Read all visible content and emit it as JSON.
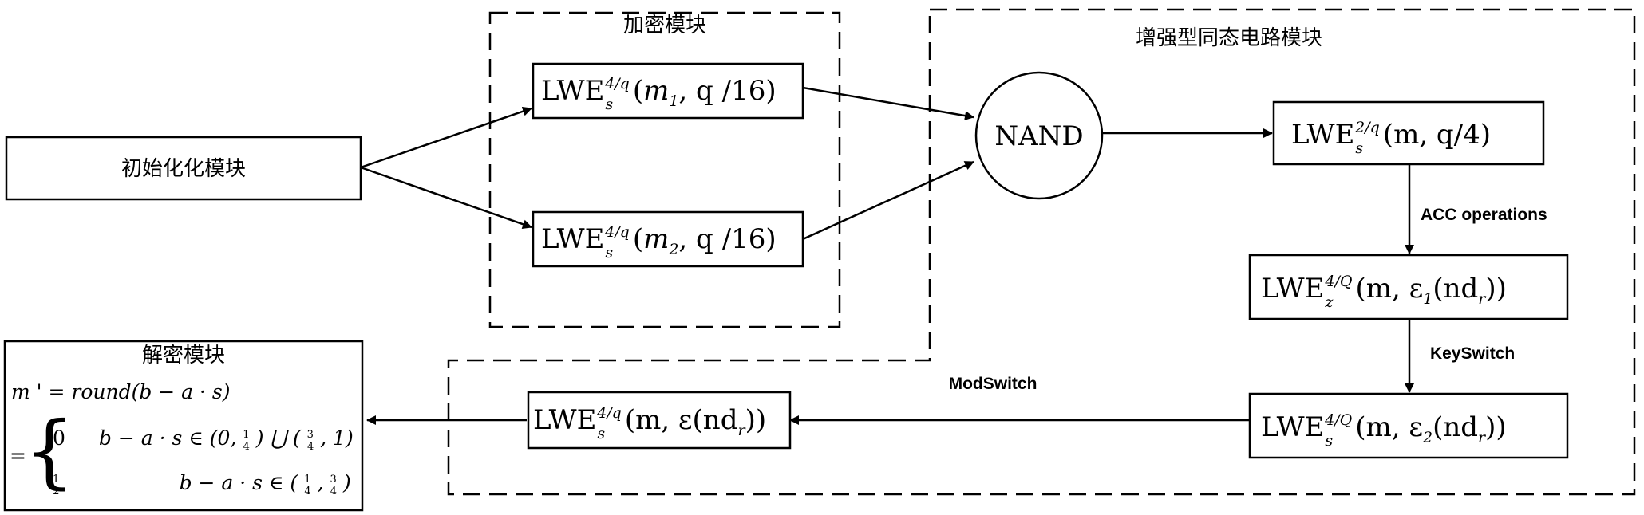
{
  "groups": {
    "encrypt_title": "加密模块",
    "circuit_title": "增强型同态电路模块"
  },
  "init": {
    "label": "初始化化模块"
  },
  "nand": {
    "label": "NAND"
  },
  "ops": {
    "acc": "ACC operations",
    "keyswitch": "KeySwitch",
    "modswitch": "ModSwitch"
  },
  "lwe": {
    "name": "LWE",
    "sub_s": "s",
    "sub_z": "z",
    "sup_4q": "4/q",
    "sup_2q": "2/q",
    "sup_4Q": "4/Q",
    "enc1": {
      "m": "m",
      "sub": "1",
      "rest": ", q /16)"
    },
    "enc2": {
      "m": "m",
      "sub": "2",
      "rest": ", q /16)"
    },
    "nand_out": {
      "args": "(m, q/4)"
    },
    "acc_out": {
      "pre": "(m, ε",
      "sub": "1",
      "post": "(nd",
      "r": "r",
      "end": "))"
    },
    "ks_out": {
      "pre": "(m, ε",
      "sub": "2",
      "post": "(nd",
      "r": "r",
      "end": "))"
    },
    "ms_out": {
      "pre": "(m, ε(nd",
      "r": "r",
      "end": "))"
    }
  },
  "decrypt": {
    "title": "解密模块",
    "line1": "m ' = round(b − a · s)",
    "case1_val": "0",
    "case1_cond": "b − a · s ∈ (0, ",
    "case1_u": " ) ⋃ ( ",
    "case1_end": " , 1)",
    "case2_cond": "b − a · s ∈ ( ",
    "case2_mid": " , ",
    "case2_end": " )",
    "eq_sign": "=",
    "brace": "{",
    "frac_1": "1",
    "frac_2": "2",
    "frac_3": "3",
    "frac_4": "4"
  },
  "colors": {
    "stroke": "#000000",
    "background": "#ffffff"
  }
}
